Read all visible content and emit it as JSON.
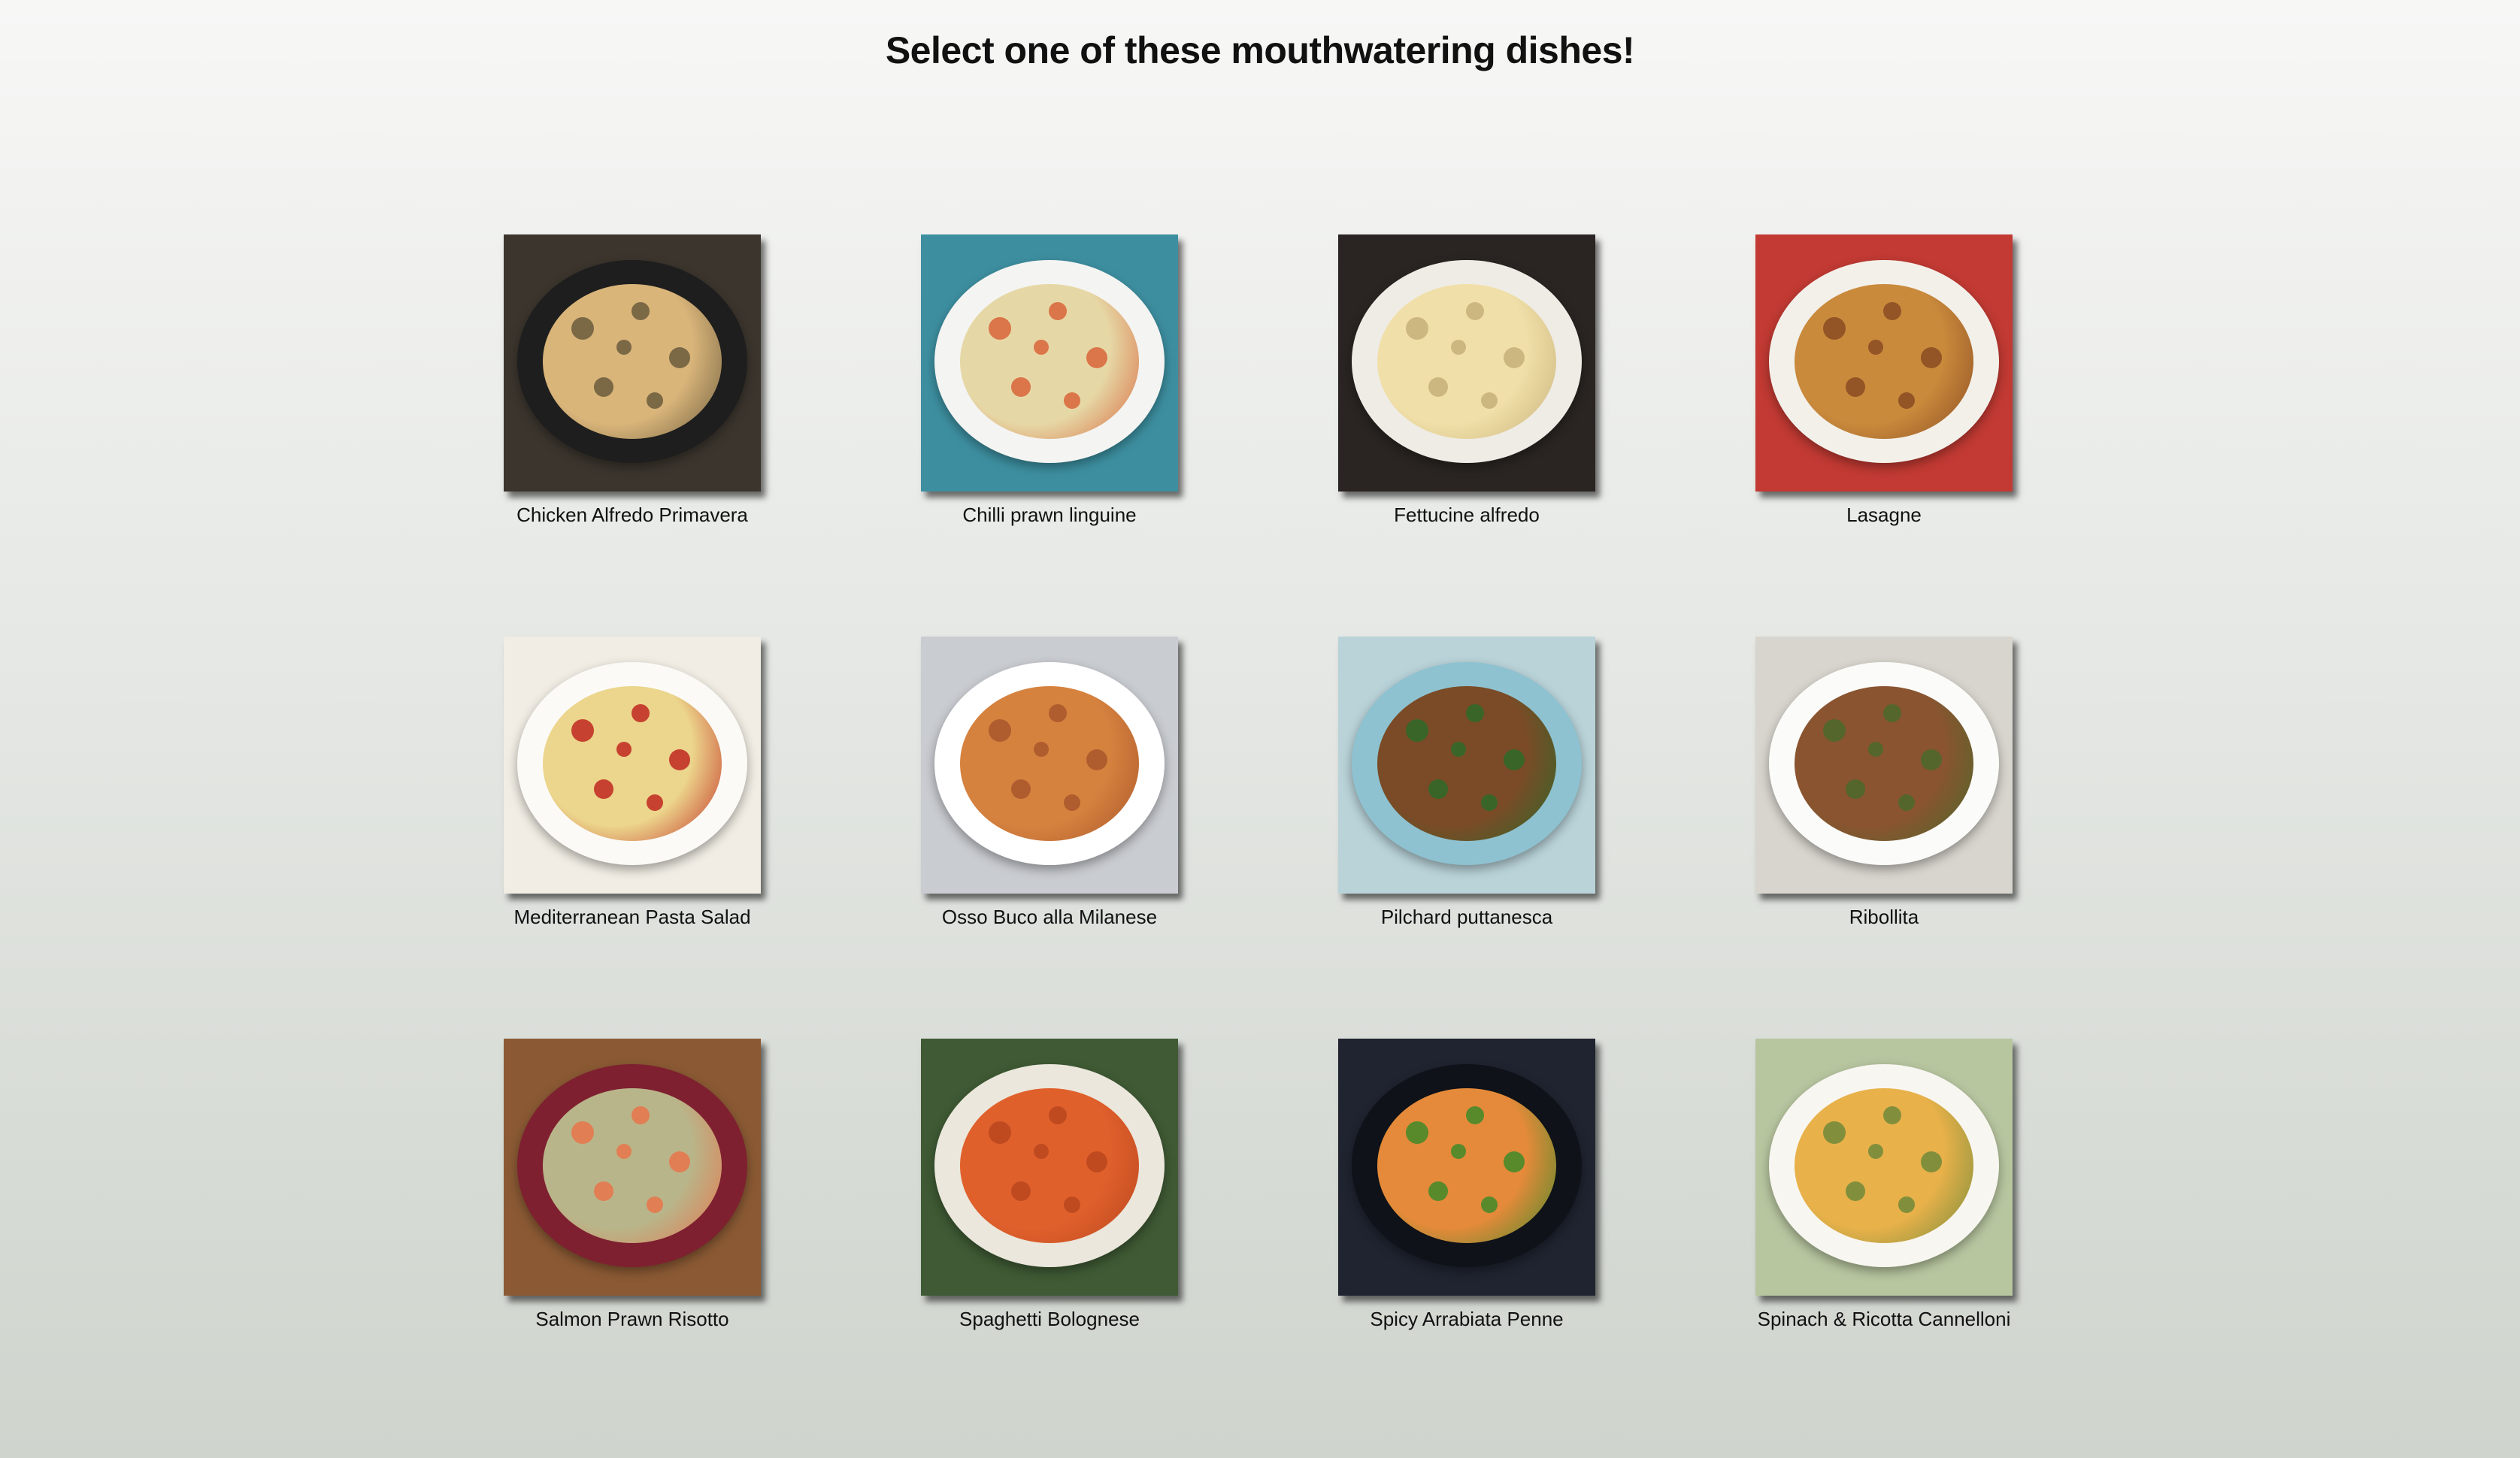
{
  "page": {
    "title": "Select one of these mouthwatering dishes!"
  },
  "dishes": [
    {
      "name": "Chicken Alfredo Primavera",
      "icon": "pasta-pan-photo",
      "bg": "#3b352d",
      "plate": "#1e1e1e",
      "food": "#d9b57a",
      "accent": "#6a5a3c"
    },
    {
      "name": "Chilli prawn linguine",
      "icon": "pasta-bowl-photo",
      "bg": "#3d8fa0",
      "plate": "#f4f4f2",
      "food": "#e6d8a6",
      "accent": "#d8643a"
    },
    {
      "name": "Fettucine alfredo",
      "icon": "pasta-plate-photo",
      "bg": "#2a2522",
      "plate": "#efece6",
      "food": "#f0dfa8",
      "accent": "#c7b07a"
    },
    {
      "name": "Lasagne",
      "icon": "lasagne-dish-photo",
      "bg": "#c23a33",
      "plate": "#f3f0ea",
      "food": "#c98a3c",
      "accent": "#8a4a22"
    },
    {
      "name": "Mediterranean Pasta Salad",
      "icon": "pasta-salad-photo",
      "bg": "#f1ede4",
      "plate": "#fbfaf6",
      "food": "#ecd58c",
      "accent": "#c0271f"
    },
    {
      "name": "Osso Buco alla Milanese",
      "icon": "stew-bowl-photo",
      "bg": "#c9ccd1",
      "plate": "#ffffff",
      "food": "#d6823f",
      "accent": "#a8562b"
    },
    {
      "name": "Pilchard puttanesca",
      "icon": "spaghetti-plate-photo",
      "bg": "#b9d3d9",
      "plate": "#8ec2d0",
      "food": "#7a4b26",
      "accent": "#2e6a2a"
    },
    {
      "name": "Ribollita",
      "icon": "soup-bowl-photo",
      "bg": "#d8d5ce",
      "plate": "#fbfbf9",
      "food": "#8a5430",
      "accent": "#4a6a2a"
    },
    {
      "name": "Salmon Prawn Risotto",
      "icon": "risotto-plate-photo",
      "bg": "#8b5a34",
      "plate": "#7e2030",
      "food": "#b9b58a",
      "accent": "#e8744a"
    },
    {
      "name": "Spaghetti Bolognese",
      "icon": "bolognese-plate-photo",
      "bg": "#3f5a34",
      "plate": "#ebe7dc",
      "food": "#e0602c",
      "accent": "#b8461e"
    },
    {
      "name": "Spicy Arrabiata Penne",
      "icon": "penne-pan-photo",
      "bg": "#1f2430",
      "plate": "#0f1218",
      "food": "#e48a3a",
      "accent": "#3f8a2a"
    },
    {
      "name": "Spinach & Ricotta Cannelloni",
      "icon": "cannelloni-dish-photo",
      "bg": "#b8c6a0",
      "plate": "#f8f6f0",
      "food": "#e8b14a",
      "accent": "#6f8a3a"
    }
  ]
}
